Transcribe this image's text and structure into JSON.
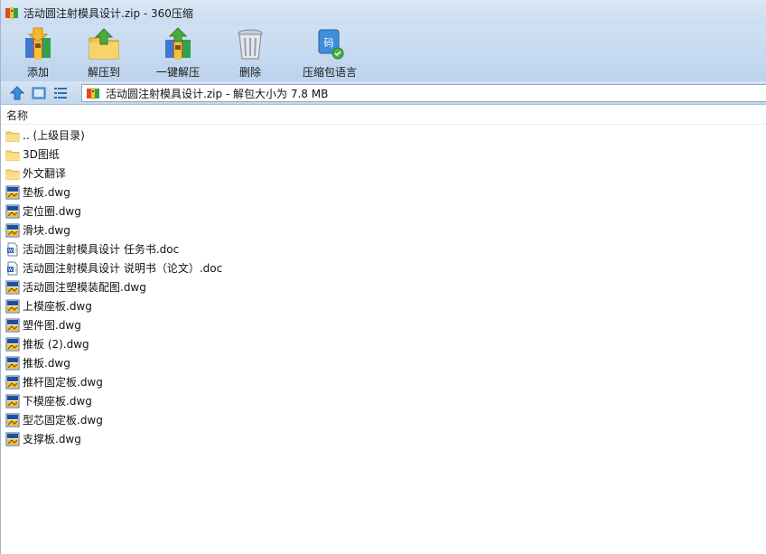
{
  "window": {
    "title": "活动圆注射模具设计.zip - 360压缩"
  },
  "toolbar": {
    "add_label": "添加",
    "extract_to_label": "解压到",
    "one_click_extract_label": "一键解压",
    "delete_label": "删除",
    "archive_language_label": "压缩包语言"
  },
  "navbar": {
    "address_text": "活动圆注射模具设计.zip - 解包大小为 7.8 MB"
  },
  "list": {
    "column_name": "名称",
    "items": [
      {
        "name": ".. (上级目录)",
        "icon": "folder-icon"
      },
      {
        "name": "3D图纸",
        "icon": "folder-icon"
      },
      {
        "name": "外文翻译",
        "icon": "folder-icon"
      },
      {
        "name": "垫板.dwg",
        "icon": "dwg-file-icon"
      },
      {
        "name": "定位圈.dwg",
        "icon": "dwg-file-icon"
      },
      {
        "name": "滑块.dwg",
        "icon": "dwg-file-icon"
      },
      {
        "name": "活动圆注射模具设计 任务书.doc",
        "icon": "doc-file-icon"
      },
      {
        "name": "活动圆注射模具设计 说明书（论文）.doc",
        "icon": "doc-file-icon"
      },
      {
        "name": "活动圆注塑模装配图.dwg",
        "icon": "dwg-file-icon"
      },
      {
        "name": "上模座板.dwg",
        "icon": "dwg-file-icon"
      },
      {
        "name": "塑件图.dwg",
        "icon": "dwg-file-icon"
      },
      {
        "name": "推板 (2).dwg",
        "icon": "dwg-file-icon"
      },
      {
        "name": "推板.dwg",
        "icon": "dwg-file-icon"
      },
      {
        "name": "推杆固定板.dwg",
        "icon": "dwg-file-icon"
      },
      {
        "name": "下模座板.dwg",
        "icon": "dwg-file-icon"
      },
      {
        "name": "型芯固定板.dwg",
        "icon": "dwg-file-icon"
      },
      {
        "name": "支撑板.dwg",
        "icon": "dwg-file-icon"
      }
    ]
  }
}
